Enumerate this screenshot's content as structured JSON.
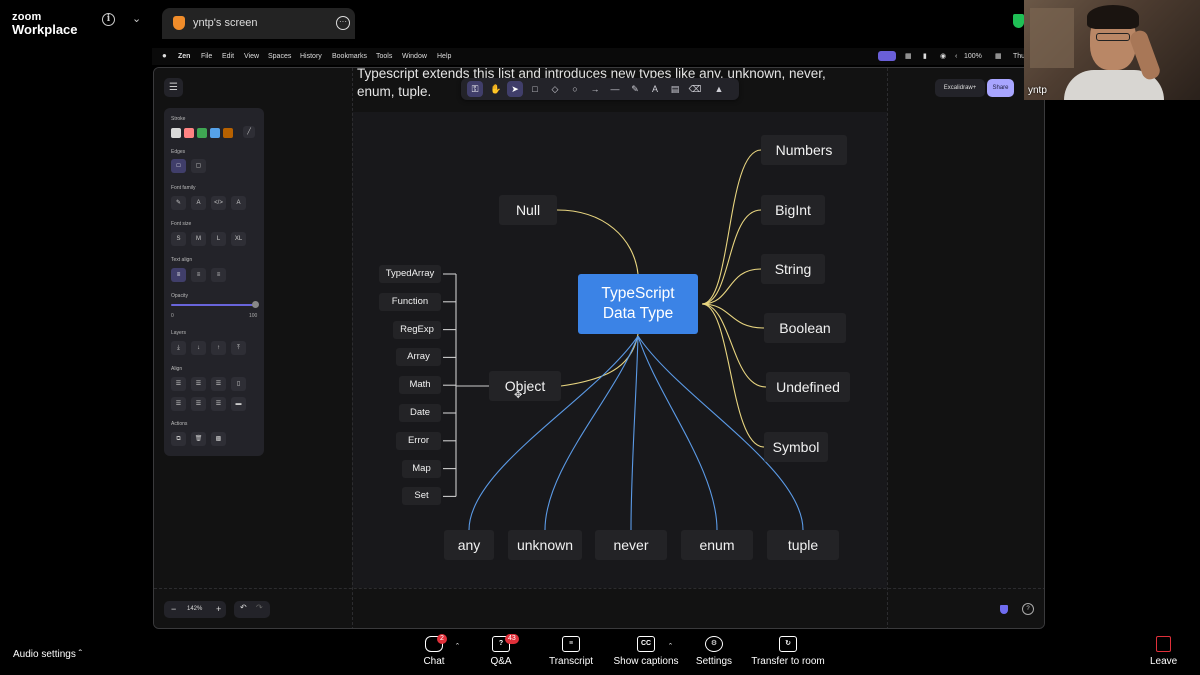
{
  "zoom": {
    "logo_line1": "zoom",
    "logo_line2": "Workplace",
    "share_tab_title": "yntp's screen",
    "audio_settings": "Audio settings",
    "controls": [
      {
        "label": "Chat",
        "badge": "2"
      },
      {
        "label": "Q&A",
        "badge": "43"
      },
      {
        "label": "Transcript",
        "badge": ""
      },
      {
        "label": "Show captions",
        "badge": ""
      },
      {
        "label": "Settings",
        "badge": ""
      },
      {
        "label": "Transfer to room",
        "badge": ""
      }
    ],
    "leave": "Leave",
    "webcam_name": "yntp"
  },
  "menubar": {
    "app": "Zen",
    "items": [
      "File",
      "Edit",
      "View",
      "Spaces",
      "History",
      "Bookmarks",
      "Tools",
      "Window",
      "Help"
    ],
    "battery": "100%",
    "clock": "Thu"
  },
  "excalidraw": {
    "heading_line1": "Typescript extends this list and introduces new types like any, unknown, never,",
    "heading_line2": "enum, tuple.",
    "excalidraw_plus": "Excalidraw+",
    "share": "Share",
    "zoom_level": "142%",
    "props": {
      "stroke": "Stroke",
      "edges": "Edges",
      "font_family": "Font family",
      "font_size": "Font size",
      "sizes": [
        "S",
        "M",
        "L",
        "XL"
      ],
      "text_align": "Text align",
      "opacity": "Opacity",
      "opacity_min": "0",
      "opacity_max": "100",
      "layers": "Layers",
      "align": "Align",
      "actions": "Actions"
    },
    "stroke_colors": [
      "#d9d9d9",
      "#ff8383",
      "#3fa653",
      "#56a2e8",
      "#b76100"
    ],
    "toolbar_tools": [
      "lock-icon",
      "hand-icon",
      "selection-icon",
      "rectangle-icon",
      "diamond-icon",
      "ellipse-icon",
      "arrow-icon",
      "line-icon",
      "pencil-icon",
      "text-icon",
      "image-icon",
      "eraser-icon",
      "more-tools-icon"
    ]
  },
  "diagram": {
    "center_line1": "TypeScript",
    "center_line2": "Data Type",
    "null": "Null",
    "object": "Object",
    "right_types": [
      "Numbers",
      "BigInt",
      "String",
      "Boolean",
      "Undefined",
      "Symbol"
    ],
    "object_types": [
      "TypedArray",
      "Function",
      "RegExp",
      "Array",
      "Math",
      "Date",
      "Error",
      "Map",
      "Set"
    ],
    "ts_types": [
      "any",
      "unknown",
      "never",
      "enum",
      "tuple"
    ],
    "colors": {
      "center": "#3b83e6",
      "yellow_line": "#e8d580",
      "blue_line": "#5b9ae6",
      "object_line": "#cccccc"
    }
  }
}
